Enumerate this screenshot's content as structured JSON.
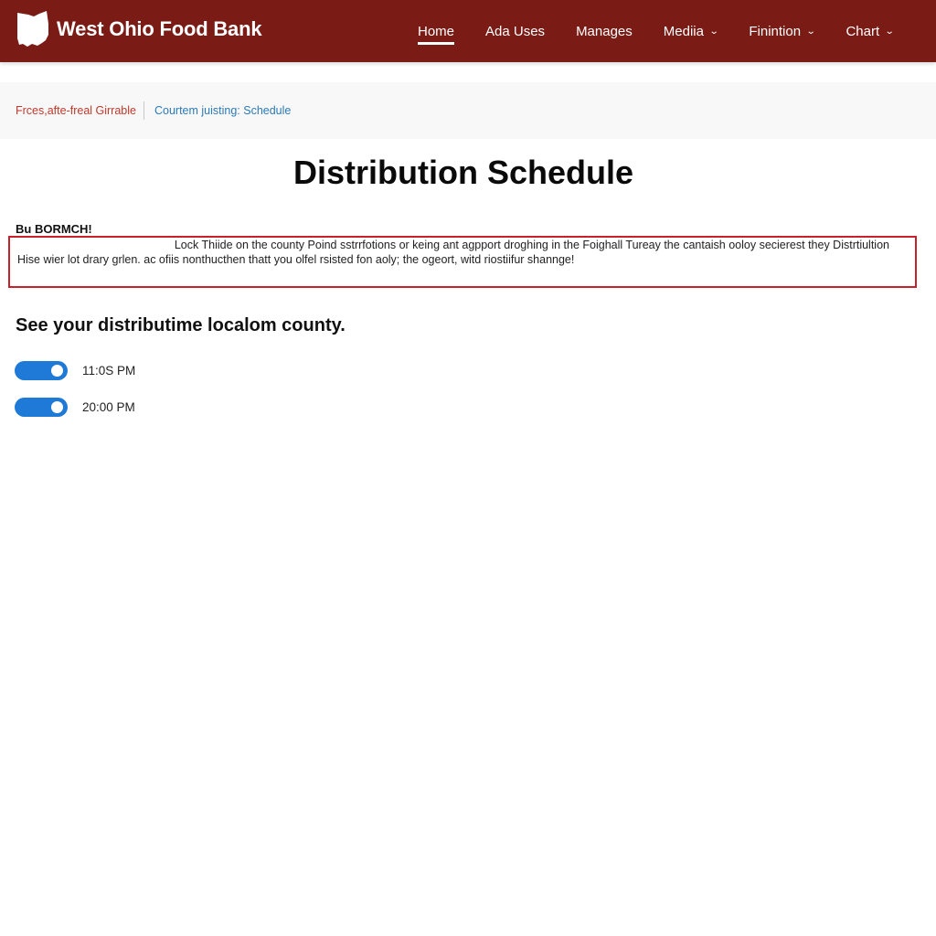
{
  "header": {
    "brand_name": "West Ohio Food Bank",
    "logo_icon": "ohio-state-outline-icon",
    "colors": {
      "bar": "#7a1c15",
      "text": "#ffffff"
    },
    "nav": [
      {
        "label": "Home",
        "active": true,
        "has_dropdown": false
      },
      {
        "label": "Ada Uses",
        "active": false,
        "has_dropdown": false
      },
      {
        "label": "Manages",
        "active": false,
        "has_dropdown": false
      },
      {
        "label": "Mediia",
        "active": false,
        "has_dropdown": true
      },
      {
        "label": "Finintion",
        "active": false,
        "has_dropdown": true
      },
      {
        "label": "Chart",
        "active": false,
        "has_dropdown": true
      }
    ],
    "dropdown_glyph": "⌄"
  },
  "breadcrumb": {
    "left_link": "Frces,afte-freal Girrable",
    "right_link": "Courtem juisting: Schedule",
    "colors": {
      "left": "#c0392b",
      "right": "#2a7ab8"
    }
  },
  "main": {
    "title": "Distribution Schedule",
    "notice": {
      "label": "Bu BORMCH!",
      "line1": "Lock Thiide on the county Poind sstrrfotions or keing ant agpport droghing in the Foighall Tureay the cantaish ooloy secierest they Distrtiultion",
      "line2": "Hise wier lot drary grlen. ac ofiis nonthucthen thatt you olfel rsisted fon aoly; the ogeort, witd riostiifur shannge!",
      "border_color": "#c8212b"
    },
    "section_heading": "See your distributime localom county.",
    "toggles": [
      {
        "label": "11:0S PM",
        "on": true
      },
      {
        "label": "20:00 PM",
        "on": true
      }
    ],
    "toggle_color": "#1e7ad6"
  }
}
